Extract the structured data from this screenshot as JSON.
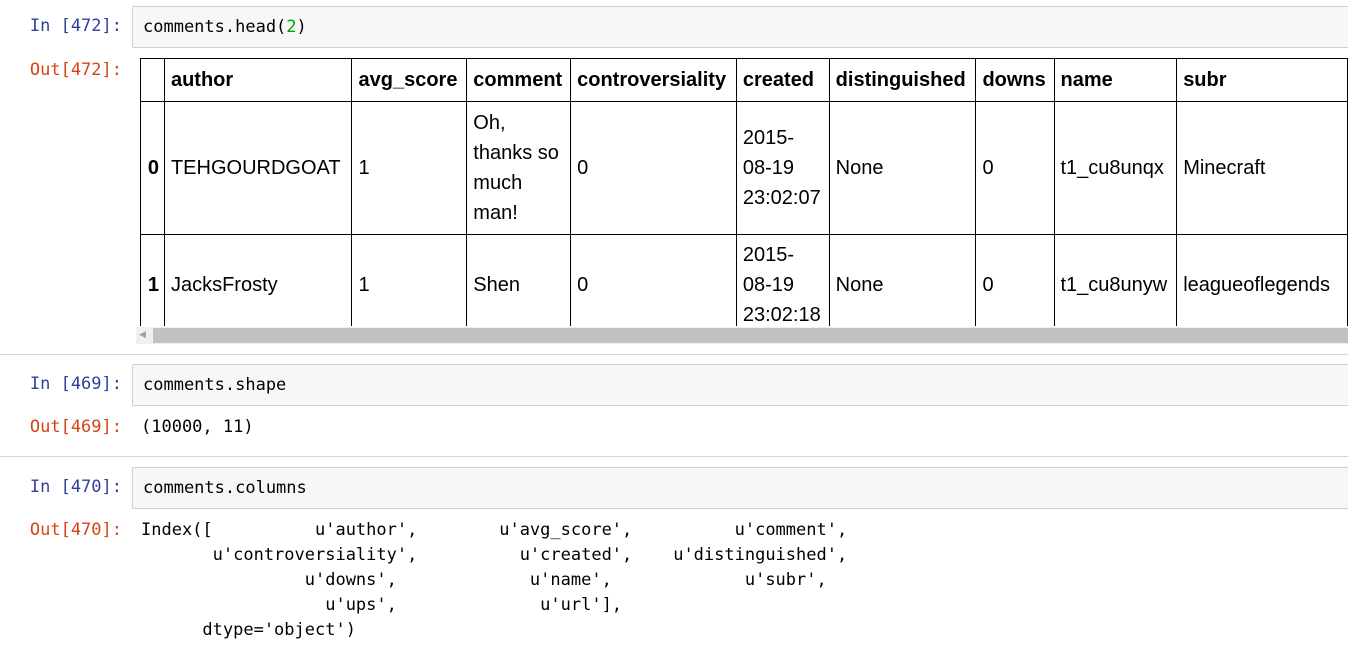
{
  "cells": [
    {
      "in_prompt": "In [472]:",
      "code_text": "comments.head(",
      "code_arg": "2",
      "code_close": ")",
      "out_prompt": "Out[472]:",
      "table": {
        "columns": [
          "",
          "author",
          "avg_score",
          "comment",
          "controversiality",
          "created",
          "distinguished",
          "downs",
          "name",
          "subr"
        ],
        "rows": [
          {
            "index": "0",
            "author": "TEHGOURDGOAT",
            "avg_score": "1",
            "comment": "Oh, thanks so much man!",
            "controversiality": "0",
            "created": "2015-08-19 23:02:07",
            "distinguished": "None",
            "downs": "0",
            "name": "t1_cu8unqx",
            "subr": "Minecraft"
          },
          {
            "index": "1",
            "author": "JacksFrosty",
            "avg_score": "1",
            "comment": "Shen",
            "controversiality": "0",
            "created": "2015-08-19 23:02:18",
            "distinguished": "None",
            "downs": "0",
            "name": "t1_cu8unyw",
            "subr": "leagueoflegends"
          }
        ]
      }
    },
    {
      "in_prompt": "In [469]:",
      "code_text": "comments.shape",
      "out_prompt": "Out[469]:",
      "output": "(10000, 11)"
    },
    {
      "in_prompt": "In [470]:",
      "code_text": "comments.columns",
      "out_prompt": "Out[470]:",
      "output_lines": [
        "Index([          u'author',        u'avg_score',          u'comment',",
        "       u'controversiality',          u'created',    u'distinguished',",
        "                u'downs',             u'name',             u'subr',",
        "                  u'ups',              u'url'],",
        "      dtype='object')"
      ]
    }
  ]
}
